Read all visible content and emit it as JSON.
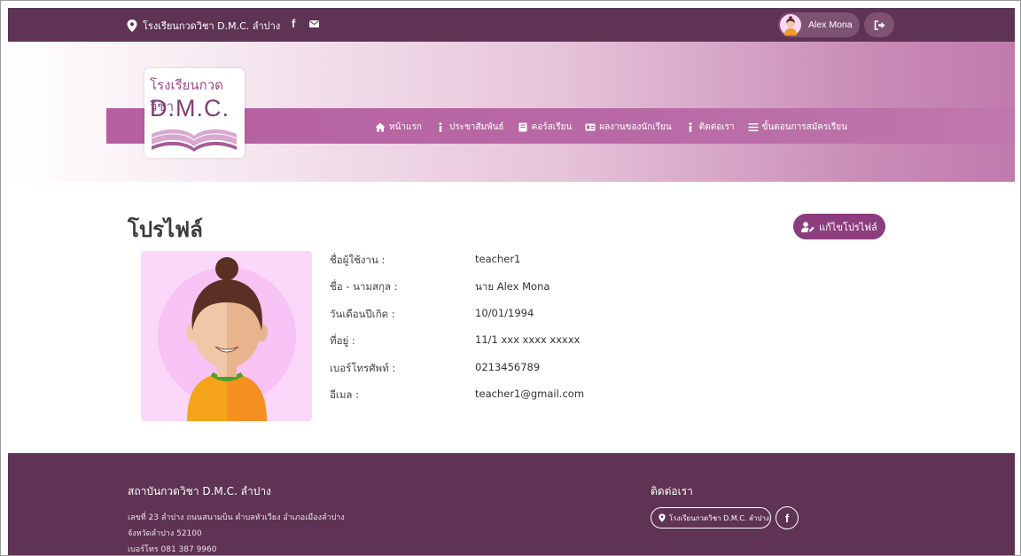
{
  "topbar": {
    "location_text": "โรงเรียนกวดวิชา D.M.C. ลำปาง",
    "facebook_glyph": "f",
    "user_name": "Alex Mona",
    "icons": [
      "location-pin-icon",
      "facebook-icon",
      "mail-icon",
      "user-avatar-icon",
      "logout-icon"
    ]
  },
  "logo": {
    "thai_text": "โรงเรียนกวดวิชา",
    "brand_text": "D.M.C."
  },
  "nav": {
    "items": [
      {
        "label": "หน้าแรก",
        "icon": "home-icon"
      },
      {
        "label": "ประชาสัมพันธ์",
        "icon": "info-icon"
      },
      {
        "label": "คอร์สเรียน",
        "icon": "book-icon"
      },
      {
        "label": "ผลงานของนักเรียน",
        "icon": "id-card-icon"
      },
      {
        "label": "ติดต่อเรา",
        "icon": "info-icon"
      },
      {
        "label": "ขั้นตอนการสมัครเรียน",
        "icon": "list-icon"
      }
    ]
  },
  "profile": {
    "title": "โปรไฟล์",
    "edit_button": "แก้ไขโปรไฟล์",
    "fields": [
      {
        "label": "ชื่อผู้ใช้งาน :",
        "value": "teacher1"
      },
      {
        "label": "ชื่อ - นามสกุล :",
        "value": "นาย Alex Mona"
      },
      {
        "label": "วันเดือนปีเกิด :",
        "value": "10/01/1994"
      },
      {
        "label": "ที่อยู่ :",
        "value": "11/1 xxx xxxx xxxxx"
      },
      {
        "label": "เบอร์โทรศัพท์ :",
        "value": "0213456789"
      },
      {
        "label": "อีเมล :",
        "value": "teacher1@gmail.com"
      }
    ]
  },
  "footer": {
    "org_title": "สถาบันกวดวิชา D.M.C. ลำปาง",
    "address_line1": "เลขที่ 23 ลำปาง ถนนสนามบิน ตำบลหัวเวียง อำเภอเมืองลำปาง",
    "address_line2": "จังหวัดลำปาง 52100",
    "phone_line": "เบอร์โทร 081 387 9960",
    "contact_title": "ติดต่อเรา",
    "contact_pill": "โรงเรียนกวดวิชา D.M.C. ลำปาง",
    "facebook_glyph": "f"
  },
  "colors": {
    "topbar": "#5e3353",
    "nav_band": "#b65fa1",
    "accent_button": "#8c3d7e",
    "footer": "#5e3353",
    "avatar_bg": "#fbd7fa"
  }
}
